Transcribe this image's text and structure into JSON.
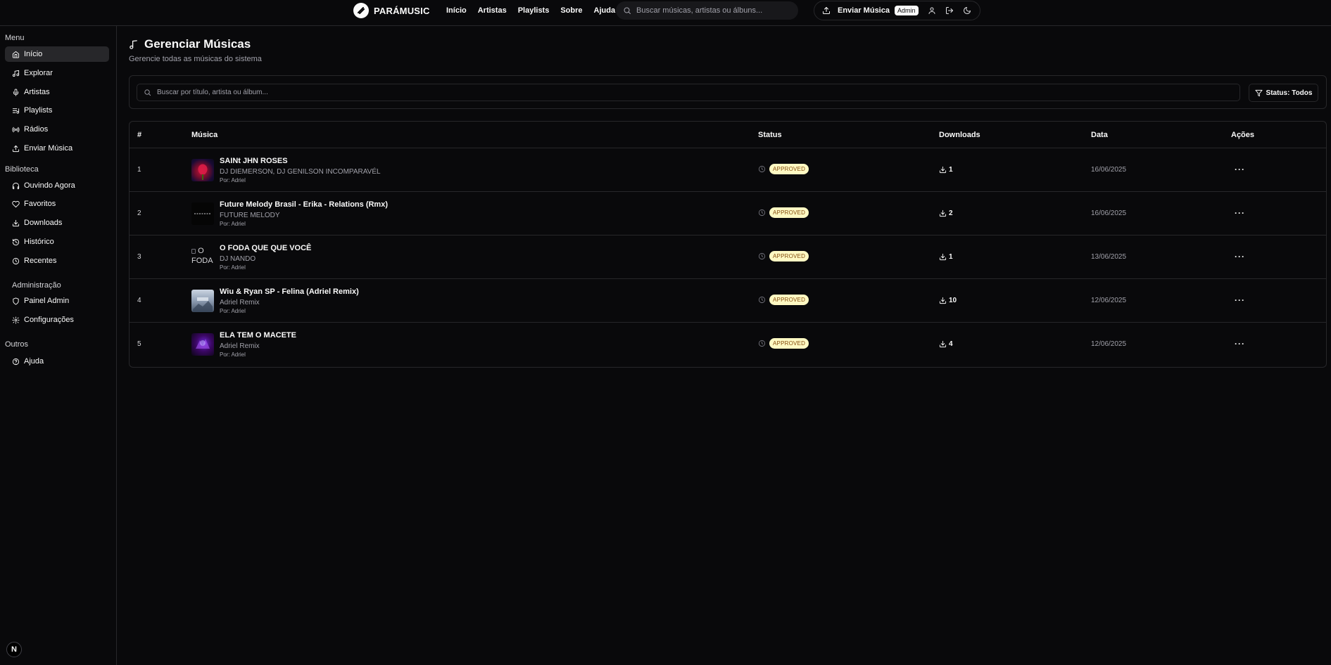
{
  "topbar": {
    "logo_text": "PARÁMUSIC",
    "nav": [
      "Início",
      "Artistas",
      "Playlists",
      "Sobre",
      "Ajuda"
    ],
    "search_placeholder": "Buscar músicas, artistas ou álbuns...",
    "send_label": "Enviar Música",
    "admin_badge": "Admin"
  },
  "sidebar": {
    "menu_title": "Menu",
    "menu_items": [
      {
        "label": "Início",
        "icon": "home-icon",
        "active": true
      },
      {
        "label": "Explorar",
        "icon": "music-icon"
      },
      {
        "label": "Artistas",
        "icon": "mic-icon"
      },
      {
        "label": "Playlists",
        "icon": "list-music-icon"
      },
      {
        "label": "Rádios",
        "icon": "radio-icon"
      },
      {
        "label": "Enviar Música",
        "icon": "upload-icon"
      }
    ],
    "library_title": "Biblioteca",
    "library_items": [
      {
        "label": "Ouvindo Agora",
        "icon": "headphones-icon"
      },
      {
        "label": "Favoritos",
        "icon": "heart-icon"
      },
      {
        "label": "Downloads",
        "icon": "download-icon"
      },
      {
        "label": "Histórico",
        "icon": "history-icon"
      },
      {
        "label": "Recentes",
        "icon": "clock-icon"
      }
    ],
    "admin_title": "Administração",
    "admin_items": [
      {
        "label": "Painel Admin",
        "icon": "shield-icon"
      },
      {
        "label": "Configurações",
        "icon": "gear-icon"
      }
    ],
    "other_title": "Outros",
    "other_items": [
      {
        "label": "Ajuda",
        "icon": "help-circle-icon"
      }
    ],
    "corner_badge": "N"
  },
  "page": {
    "title": "Gerenciar Músicas",
    "subtitle": "Gerencie todas as músicas do sistema",
    "filter_placeholder": "Buscar por título, artista ou álbum...",
    "status_filter": "Status: Todos"
  },
  "table": {
    "headers": {
      "num": "#",
      "music": "Música",
      "status": "Status",
      "downloads": "Downloads",
      "date": "Data",
      "actions": "Ações"
    },
    "rows": [
      {
        "num": "1",
        "title": "SAINt JHN ROSES",
        "artist": "DJ DIEMERSON, DJ GENILSON INCOMPARAVÉL",
        "by": "Por: Adriel",
        "status": "APPROVED",
        "downloads": "1",
        "date": "16/06/2025",
        "cover": "rose"
      },
      {
        "num": "2",
        "title": "Future Melody Brasil - Erika - Relations (Rmx)",
        "artist": "FUTURE MELODY",
        "by": "Por: Adriel",
        "status": "APPROVED",
        "downloads": "2",
        "date": "16/06/2025",
        "cover": "dark"
      },
      {
        "num": "3",
        "title": "O FODA QUE QUE VOCÊ",
        "artist": "DJ NANDO",
        "by": "Por: Adriel",
        "status": "APPROVED",
        "downloads": "1",
        "date": "13/06/2025",
        "cover": "broken",
        "cover_alt": "O FODA"
      },
      {
        "num": "4",
        "title": "Wiu & Ryan SP - Felina (Adriel Remix)",
        "artist": "Adriel Remix",
        "by": "Por: Adriel",
        "status": "APPROVED",
        "downloads": "10",
        "date": "12/06/2025",
        "cover": "grey"
      },
      {
        "num": "5",
        "title": "ELA TEM O MACETE",
        "artist": "Adriel Remix",
        "by": "Por: Adriel",
        "status": "APPROVED",
        "downloads": "4",
        "date": "12/06/2025",
        "cover": "purple"
      }
    ]
  },
  "colors": {
    "background": "#09090b",
    "border": "#27272a",
    "badge_bg": "#fef9c3",
    "badge_text": "#854d0e"
  }
}
